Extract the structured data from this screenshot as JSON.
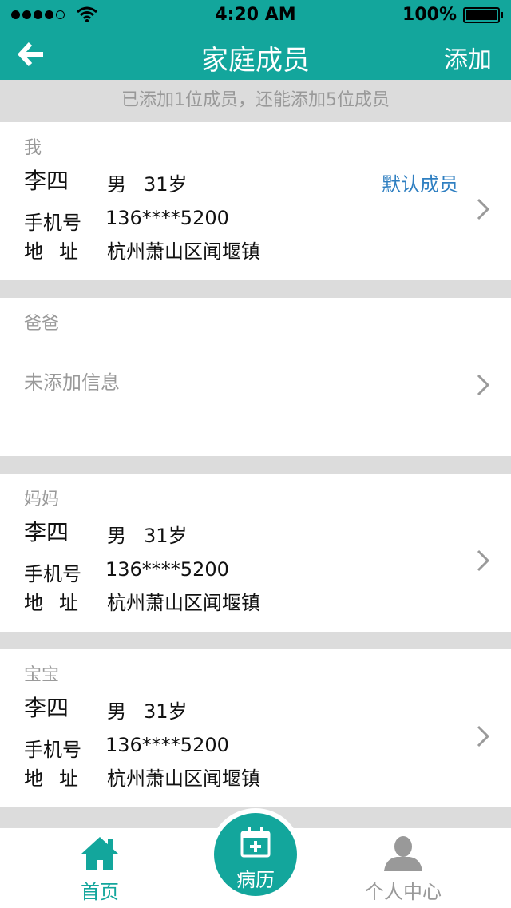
{
  "status_bar": {
    "time": "4:20 AM",
    "battery": "100%"
  },
  "nav": {
    "title": "家庭成员",
    "add_label": "添加"
  },
  "info_strip": "已添加1位成员，还能添加5位成员",
  "members": [
    {
      "relation": "我",
      "name": "李四",
      "gender": "男",
      "age": "31岁",
      "phone_label": "手机号",
      "phone": "136****5200",
      "addr_label": "地址",
      "address": "杭州萧山区闻堰镇",
      "default_label": "默认成员"
    },
    {
      "relation": "爸爸",
      "empty_note": "未添加信息"
    },
    {
      "relation": "妈妈",
      "name": "李四",
      "gender": "男",
      "age": "31岁",
      "phone_label": "手机号",
      "phone": "136****5200",
      "addr_label": "地址",
      "address": "杭州萧山区闻堰镇"
    },
    {
      "relation": "宝宝",
      "name": "李四",
      "gender": "男",
      "age": "31岁",
      "phone_label": "手机号",
      "phone": "136****5200",
      "addr_label": "地址",
      "address": "杭州萧山区闻堰镇"
    }
  ],
  "tabs": {
    "home": "首页",
    "records": "病历",
    "profile": "个人中心"
  },
  "colors": {
    "primary": "#13a69c",
    "link": "#2f7fc1",
    "muted": "#9a9a9a"
  },
  "icons": {
    "back": "arrow-left-icon",
    "chevron": "chevron-right-icon",
    "home": "house-icon",
    "records": "calendar-plus-icon",
    "profile": "person-icon"
  }
}
